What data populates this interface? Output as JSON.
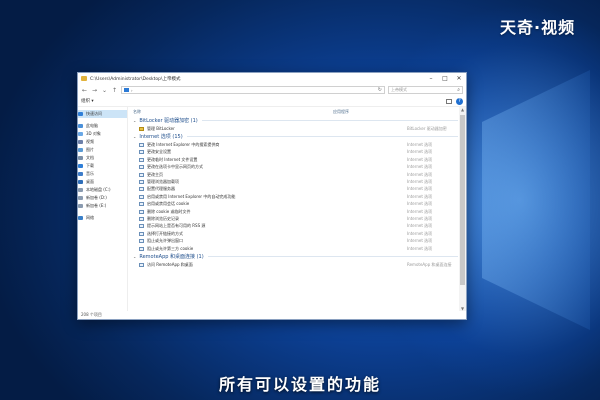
{
  "watermark": "天奇·视频",
  "subtitle": "所有可以设置的功能",
  "window": {
    "title": "C:\\Users\\Administrator\\Desktop\\上帝模式",
    "address_text": "›",
    "search_placeholder": "上帝模式",
    "organize_label": "组织 ▾",
    "status": "208 个项目",
    "columns": {
      "name": "名称",
      "app": "应用程序"
    }
  },
  "nav": [
    {
      "label": "快速访问",
      "icon": "star-icon",
      "color": "#2f7fd8",
      "selected": true
    },
    {
      "label": "",
      "gap": true
    },
    {
      "label": "此电脑",
      "icon": "computer-icon",
      "color": "#4a90d9"
    },
    {
      "label": "3D 对象",
      "icon": "cube-icon",
      "color": "#6aa8e6"
    },
    {
      "label": "视频",
      "icon": "video-icon",
      "color": "#6c7fa8"
    },
    {
      "label": "图片",
      "icon": "picture-icon",
      "color": "#5a9bd5"
    },
    {
      "label": "文档",
      "icon": "document-icon",
      "color": "#7a8fa8"
    },
    {
      "label": "下载",
      "icon": "download-icon",
      "color": "#2f7fd8"
    },
    {
      "label": "音乐",
      "icon": "music-icon",
      "color": "#3d7cc9"
    },
    {
      "label": "桌面",
      "icon": "desktop-icon",
      "color": "#2e6db8"
    },
    {
      "label": "本地磁盘 (C:)",
      "icon": "drive-icon",
      "color": "#8a9bb0"
    },
    {
      "label": "新加卷 (D:)",
      "icon": "drive-icon",
      "color": "#8a9bb0"
    },
    {
      "label": "新加卷 (E:)",
      "icon": "drive-icon",
      "color": "#8a9bb0"
    },
    {
      "label": "",
      "gap": true
    },
    {
      "label": "网络",
      "icon": "network-icon",
      "color": "#3a7fc8"
    }
  ],
  "groups": [
    {
      "title": "BitLocker 驱动器加密 (1)",
      "items": [
        {
          "name": "管理 BitLocker",
          "cat": "BitLocker 驱动器加密",
          "key": true
        }
      ]
    },
    {
      "title": "Internet 选项 (15)",
      "items": [
        {
          "name": "更改 Internet Explorer 中的搜索提供商",
          "cat": "Internet 选项"
        },
        {
          "name": "更改安全设置",
          "cat": "Internet 选项"
        },
        {
          "name": "更改临时 Internet 文件设置",
          "cat": "Internet 选项"
        },
        {
          "name": "更改在选项卡中显示网页的方式",
          "cat": "Internet 选项"
        },
        {
          "name": "更改主页",
          "cat": "Internet 选项"
        },
        {
          "name": "管理浏览器加载项",
          "cat": "Internet 选项"
        },
        {
          "name": "配置代理服务器",
          "cat": "Internet 选项"
        },
        {
          "name": "启用或禁用 Internet Explorer 中的自动完成功能",
          "cat": "Internet 选项"
        },
        {
          "name": "启用或禁用会话 cookie",
          "cat": "Internet 选项"
        },
        {
          "name": "删除 cookie 或临时文件",
          "cat": "Internet 选项"
        },
        {
          "name": "删除浏览历史记录",
          "cat": "Internet 选项"
        },
        {
          "name": "提示网站上是否有可用的 RSS 源",
          "cat": "Internet 选项"
        },
        {
          "name": "选择打开链接的方式",
          "cat": "Internet 选项"
        },
        {
          "name": "阻止或允许弹出窗口",
          "cat": "Internet 选项"
        },
        {
          "name": "阻止或允许第三方 cookie",
          "cat": "Internet 选项"
        }
      ]
    },
    {
      "title": "RemoteApp 和桌面连接 (1)",
      "items": [
        {
          "name": "访问 RemoteApp 和桌面",
          "cat": "RemoteApp 和桌面连接"
        }
      ]
    }
  ]
}
